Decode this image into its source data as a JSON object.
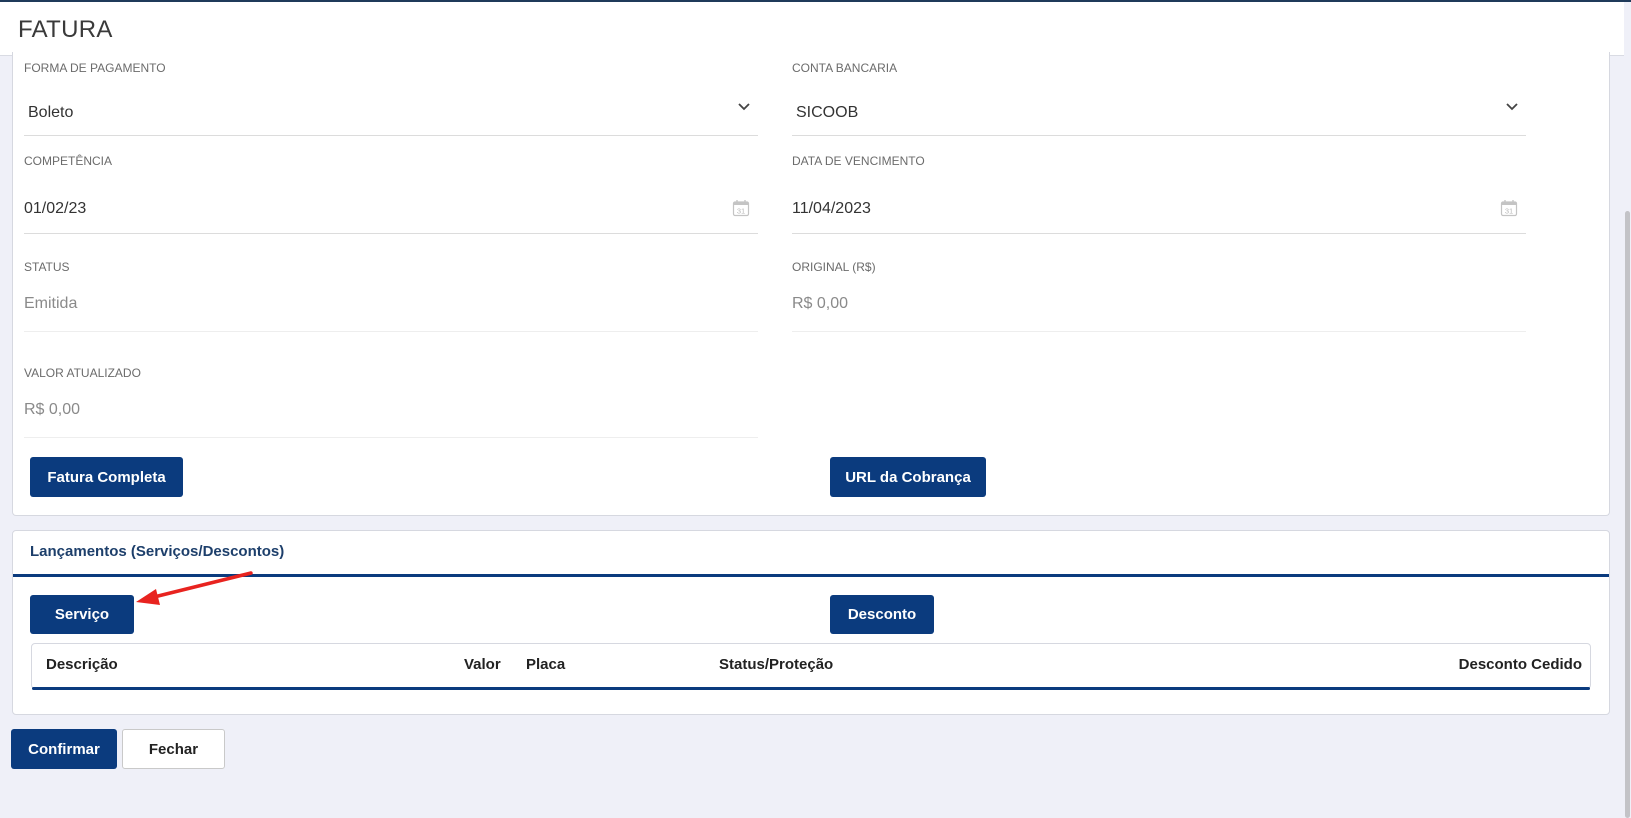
{
  "header": {
    "title": "FATURA"
  },
  "form": {
    "forma_pagamento": {
      "label": "FORMA DE PAGAMENTO",
      "value": "Boleto"
    },
    "conta_bancaria": {
      "label": "CONTA BANCARIA",
      "value": "SICOOB"
    },
    "competencia": {
      "label": "COMPETÊNCIA",
      "value": "01/02/23"
    },
    "data_vencimento": {
      "label": "DATA DE VENCIMENTO",
      "value": "11/04/2023"
    },
    "status": {
      "label": "STATUS",
      "value": "Emitida"
    },
    "original": {
      "label": "ORIGINAL (R$)",
      "value": "R$ 0,00"
    },
    "valor_atualizado": {
      "label": "VALOR ATUALIZADO",
      "value": "R$ 0,00"
    },
    "fatura_completa_label": "Fatura Completa",
    "url_cobranca_label": "URL da Cobrança"
  },
  "lancamentos": {
    "title": "Lançamentos (Serviços/Descontos)",
    "servico_label": "Serviço",
    "desconto_label": "Desconto",
    "columns": [
      "Descrição",
      "Valor",
      "Placa",
      "Status/Proteção",
      "Desconto Cedido"
    ]
  },
  "footer": {
    "confirmar_label": "Confirmar",
    "fechar_label": "Fechar"
  },
  "icons": {
    "chevron": "chevron-down-icon",
    "calendar": "calendar-icon",
    "arrow": "red-arrow-annotation"
  },
  "colors": {
    "primary": "#0b3b7e",
    "annotation": "#e8231f"
  }
}
